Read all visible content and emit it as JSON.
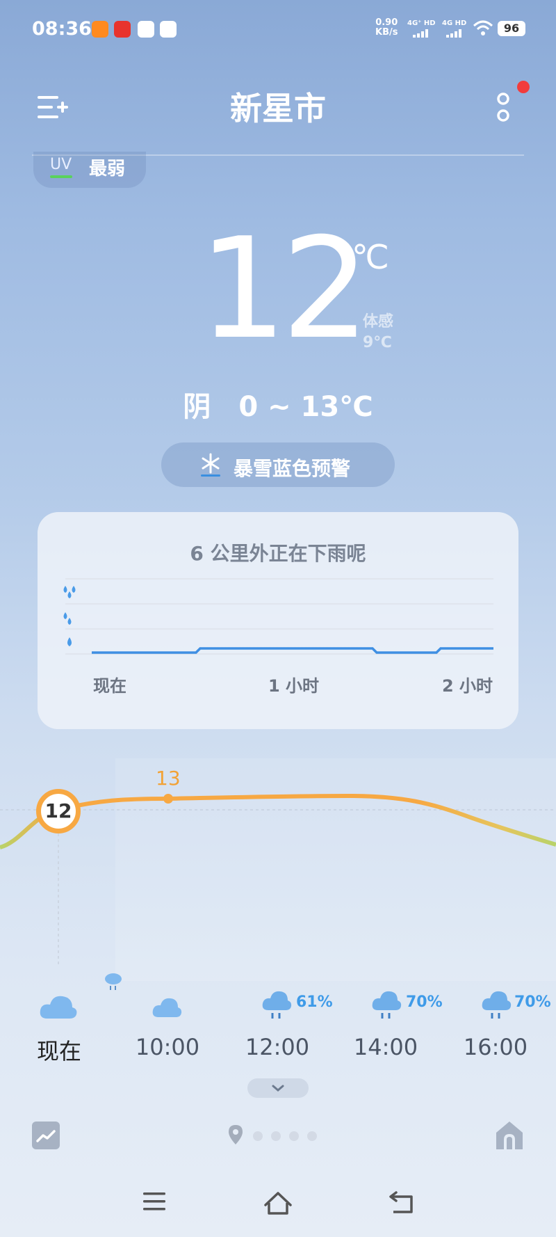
{
  "status_bar": {
    "time": "08:36",
    "net_speed_value": "0.90",
    "net_speed_unit": "KB/s",
    "sim1": "4G⁺ HD",
    "sim2": "4G HD",
    "battery": "96"
  },
  "header": {
    "city": "新星市"
  },
  "uv": {
    "label": "UV",
    "value": "最弱"
  },
  "current": {
    "temperature": "12",
    "unit": "℃",
    "feels_like_label": "体感",
    "feels_like": "9℃",
    "condition_range": "阴　0 ~ 13℃"
  },
  "alert": {
    "text": "暴雪蓝色预警",
    "icon": "snowflake-icon"
  },
  "rain_card": {
    "title": "6 公里外正在下雨呢",
    "x_labels": [
      "现在",
      "1 小时",
      "2 小时"
    ]
  },
  "hourly": {
    "now_temp": "12",
    "max_temp": "13",
    "hours": [
      {
        "label": "现在",
        "icon": "cloud-icon",
        "pop": ""
      },
      {
        "label": "10:00",
        "icon": "cloud-icon",
        "pop": ""
      },
      {
        "label": "12:00",
        "icon": "rain-cloud-icon",
        "pop": "61%"
      },
      {
        "label": "14:00",
        "icon": "rain-cloud-icon",
        "pop": "70%"
      },
      {
        "label": "16:00",
        "icon": "rain-cloud-icon",
        "pop": "70%"
      }
    ]
  },
  "colors": {
    "accent_orange": "#f7a843",
    "rain_blue": "#3f9be8",
    "notification_red": "#f23c3c"
  }
}
